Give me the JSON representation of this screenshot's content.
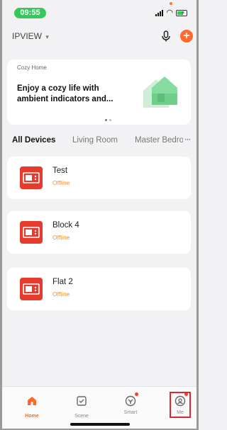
{
  "status_bar": {
    "time": "09:55"
  },
  "header": {
    "home_name": "IPVIEW",
    "caret": "▾",
    "add_label": "+"
  },
  "banner": {
    "tag": "Cozy Home",
    "text": "Enjoy a cozy life with ambient indicators and..."
  },
  "tabs": [
    {
      "label": "All Devices",
      "active": true
    },
    {
      "label": "Living Room",
      "active": false
    },
    {
      "label": "Master Bedroom",
      "active": false
    }
  ],
  "more": "···",
  "devices": [
    {
      "name": "Test",
      "status": "Offline"
    },
    {
      "name": "Block 4",
      "status": "Offline"
    },
    {
      "name": "Flat 2",
      "status": "Offline"
    }
  ],
  "bottom_nav": [
    {
      "label": "Home",
      "icon": "home-icon",
      "active": true
    },
    {
      "label": "Scene",
      "icon": "scene-icon",
      "active": false
    },
    {
      "label": "Smart",
      "icon": "smart-icon",
      "active": false,
      "badge": true
    },
    {
      "label": "Me",
      "icon": "me-icon",
      "active": false,
      "badge": true
    }
  ],
  "colors": {
    "accent": "#ff6a2c",
    "status_offline": "#ff8a1f",
    "device_icon": "#e53b2c",
    "time_pill": "#35c85a",
    "highlight": "#e0262b"
  }
}
